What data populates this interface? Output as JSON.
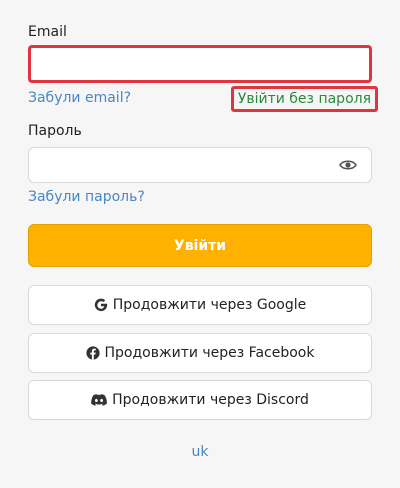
{
  "form": {
    "email_label": "Email",
    "email_value": "",
    "forgot_email": "Забули email?",
    "passwordless_login": "Увійти без пароля",
    "password_label": "Пароль",
    "password_value": "",
    "forgot_password": "Забули пароль?",
    "submit_label": "Увійти"
  },
  "social": [
    {
      "label": "Продовжити через Google",
      "icon": "google-icon"
    },
    {
      "label": "Продовжити через Facebook",
      "icon": "facebook-icon"
    },
    {
      "label": "Продовжити через Discord",
      "icon": "discord-icon"
    }
  ],
  "footer": {
    "language": "uk"
  },
  "colors": {
    "primary": "#ffb100",
    "link": "#4a86c5",
    "passwordless_link": "#2b8a3e",
    "highlight": "#e0353f"
  }
}
